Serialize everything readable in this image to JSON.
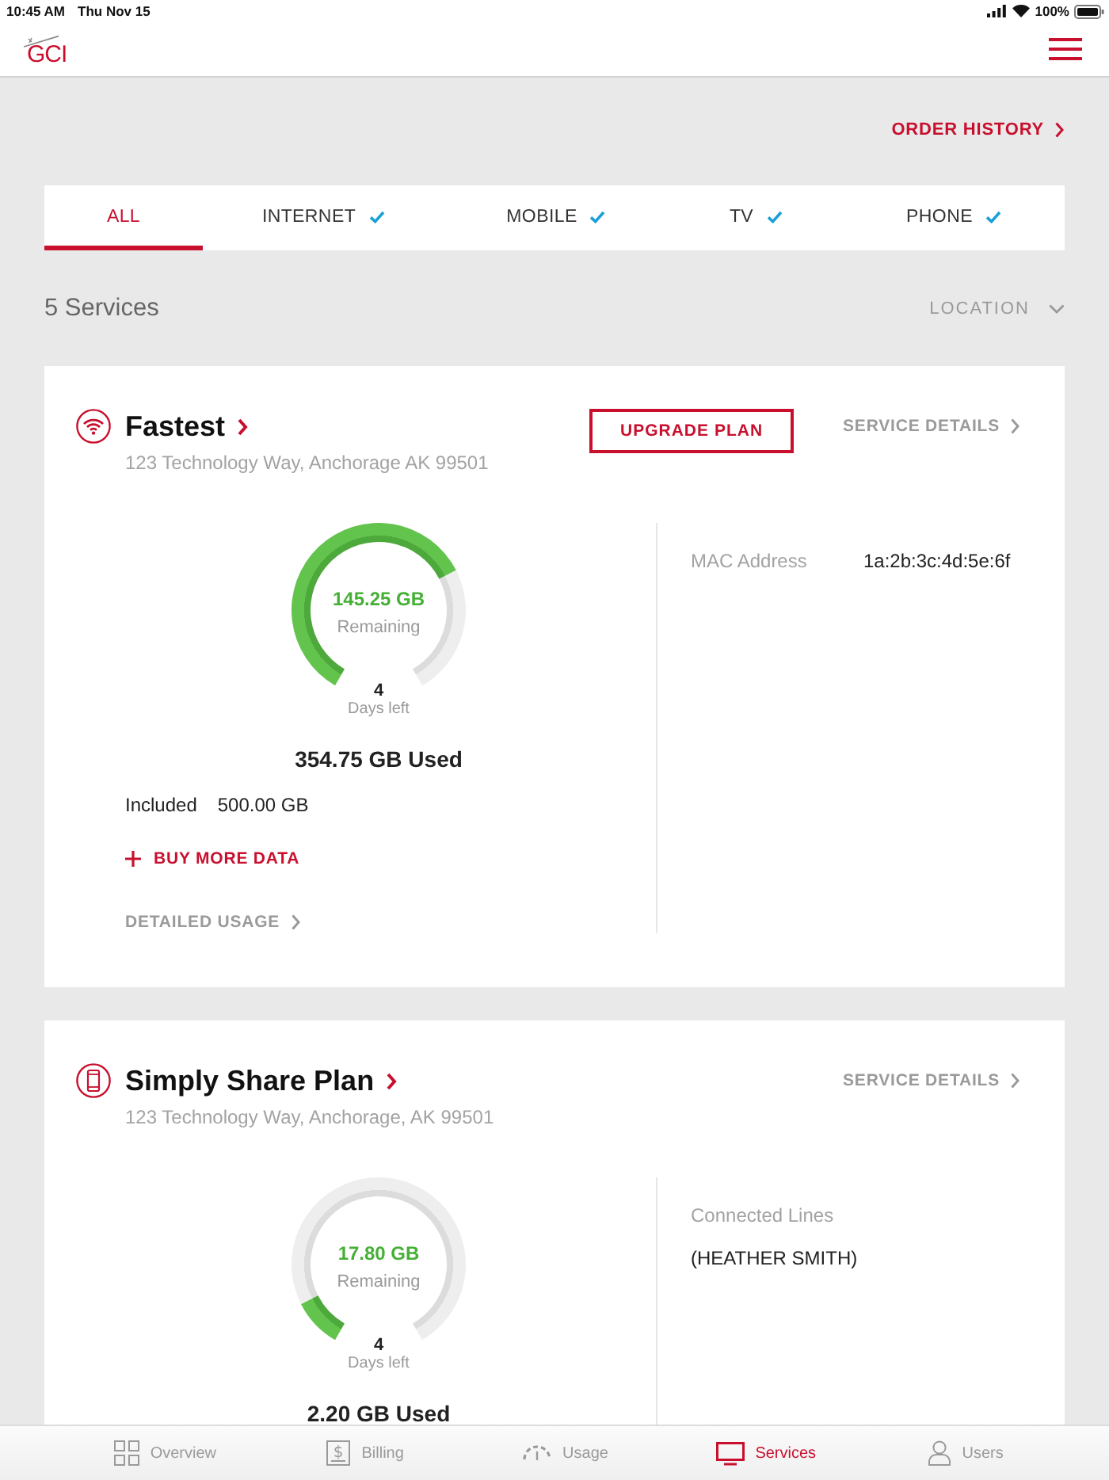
{
  "status_bar": {
    "time": "10:45 AM",
    "date": "Thu Nov 15",
    "battery": "100%"
  },
  "header": {
    "logo": "GCI"
  },
  "order_history": "ORDER HISTORY",
  "tabs": [
    {
      "label": "ALL",
      "selected": true,
      "checked": false
    },
    {
      "label": "INTERNET",
      "selected": false,
      "checked": true
    },
    {
      "label": "MOBILE",
      "selected": false,
      "checked": true
    },
    {
      "label": "TV",
      "selected": false,
      "checked": true
    },
    {
      "label": "PHONE",
      "selected": false,
      "checked": true
    }
  ],
  "services_count": "5 Services",
  "location_filter": "LOCATION",
  "services": [
    {
      "kind": "internet",
      "name": "Fastest",
      "address": "123 Technology Way, Anchorage AK 99501",
      "upgrade_button": "UPGRADE PLAN",
      "details_link": "SERVICE DETAILS",
      "chart_data": {
        "type": "donut",
        "values": [
          70.95,
          29.05
        ]
      },
      "remaining": "145.25 GB",
      "remaining_label": "Remaining",
      "days": "4",
      "days_label": "Days left",
      "used": "354.75 GB Used",
      "included_label": "Included",
      "included": "500.00 GB",
      "buy_more": "BUY MORE DATA",
      "detailed_usage": "DETAILED USAGE",
      "info": {
        "label": "MAC Address",
        "value": "1a:2b:3c:4d:5e:6f"
      }
    },
    {
      "kind": "mobile",
      "name": "Simply Share Plan",
      "address": "123 Technology Way, Anchorage, AK 99501",
      "details_link": "SERVICE DETAILS",
      "chart_data": {
        "type": "donut",
        "values": [
          11,
          89
        ]
      },
      "remaining": "17.80 GB",
      "remaining_label": "Remaining",
      "days": "4",
      "days_label": "Days left",
      "used": "2.20 GB Used",
      "info": {
        "label": "Connected Lines",
        "lines": [
          "(HEATHER SMITH)"
        ]
      }
    }
  ],
  "bottom_nav": [
    {
      "label": "Overview",
      "selected": false
    },
    {
      "label": "Billing",
      "icon_text": "$",
      "selected": false
    },
    {
      "label": "Usage",
      "selected": false
    },
    {
      "label": "Services",
      "selected": true
    },
    {
      "label": "Users",
      "selected": false
    }
  ]
}
